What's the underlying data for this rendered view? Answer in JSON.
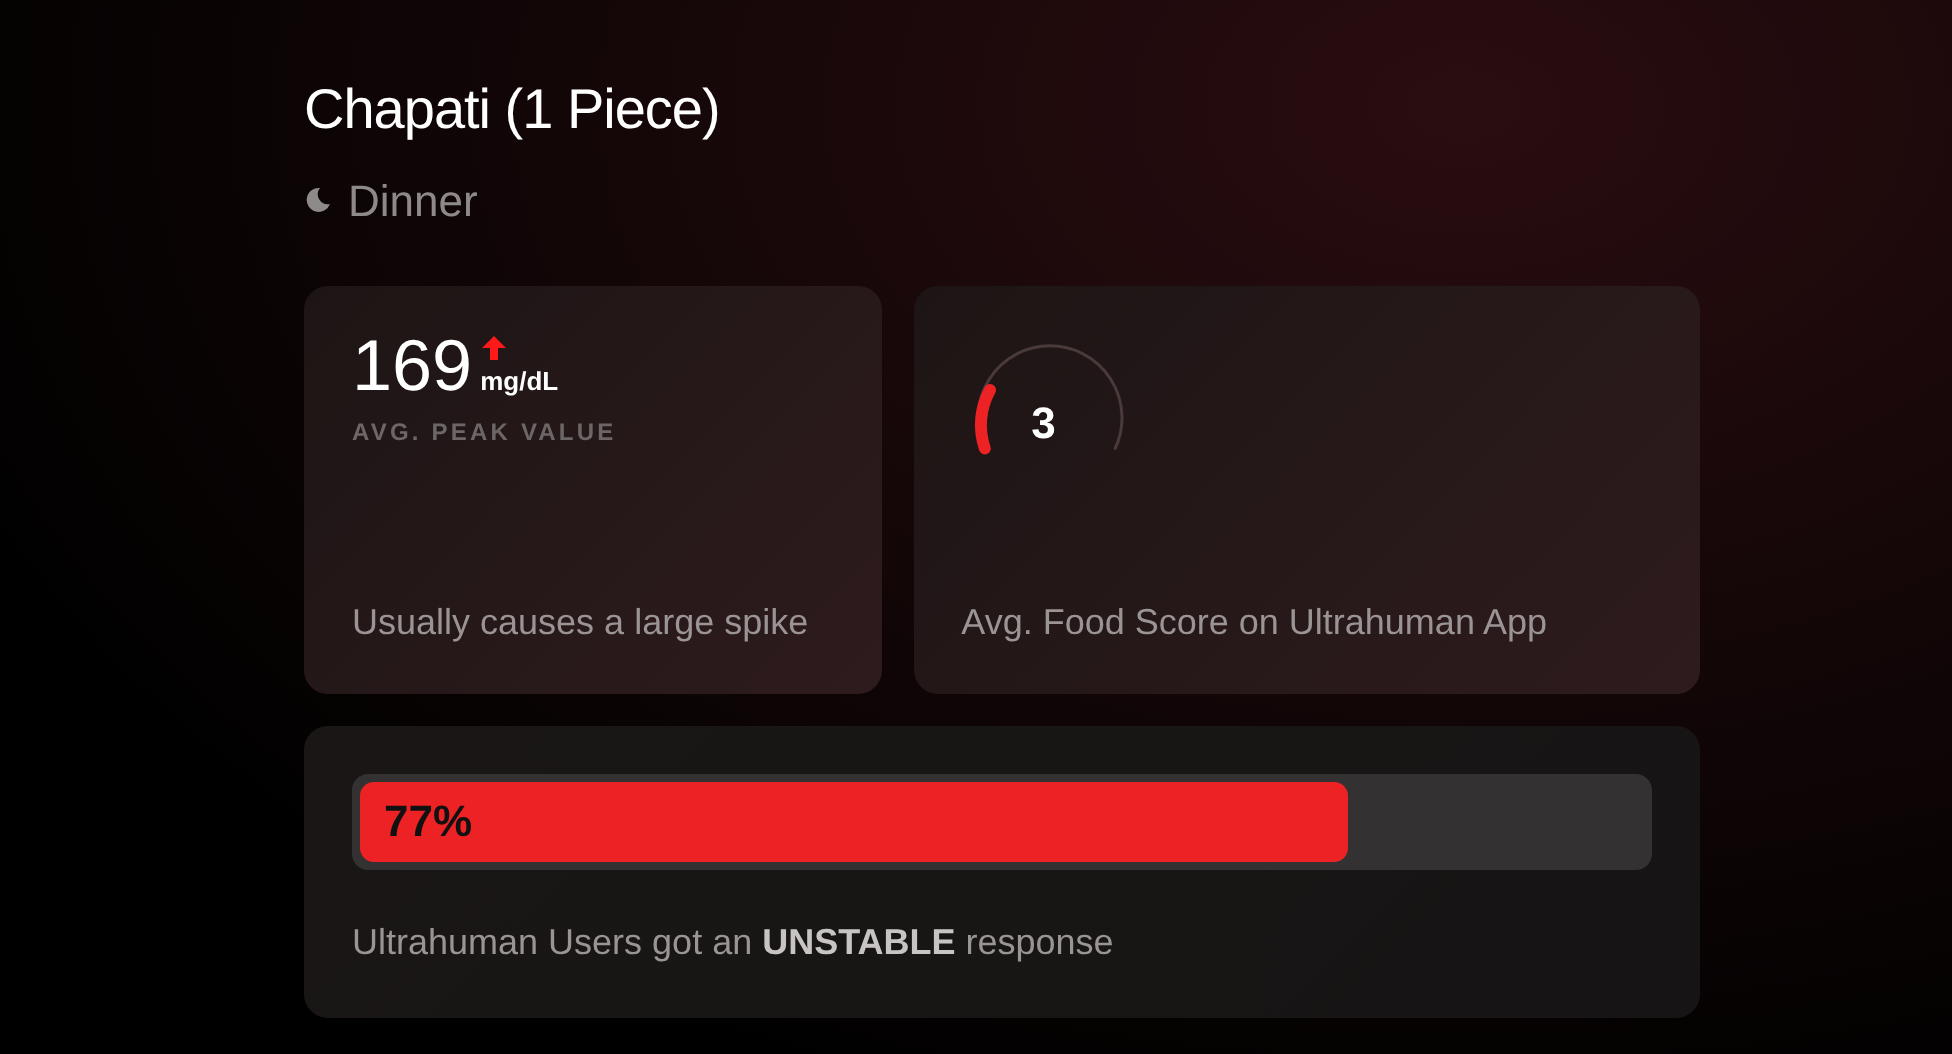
{
  "title": "Chapati (1 Piece)",
  "meal": {
    "label": "Dinner"
  },
  "peak_card": {
    "value": "169",
    "unit": "mg/dL",
    "caption": "AVG. PEAK VALUE",
    "note": "Usually causes a large spike"
  },
  "score_card": {
    "score": "3",
    "note": "Avg. Food Score on Ultrahuman App"
  },
  "response_card": {
    "level": 0.77,
    "reading": "77%",
    "note": "Ultrahuman Users got an **UNSTABLE** response"
  }
}
